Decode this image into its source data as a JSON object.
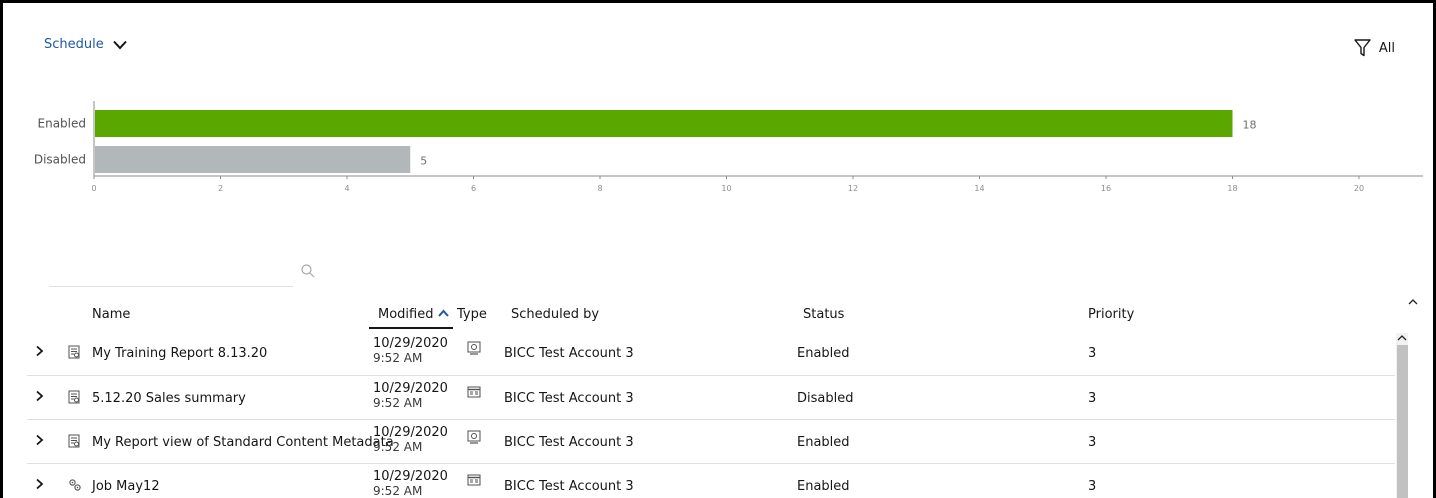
{
  "header": {
    "schedule_label": "Schedule",
    "filter_label": "All"
  },
  "chart_data": {
    "type": "bar",
    "orientation": "horizontal",
    "categories": [
      "Enabled",
      "Disabled"
    ],
    "values": [
      18,
      5
    ],
    "colors": [
      "#5aa700",
      "#b2b7ba"
    ],
    "xlim": [
      0,
      20
    ],
    "xticks": [
      0,
      2,
      4,
      6,
      8,
      10,
      12,
      14,
      16,
      18,
      20
    ],
    "grid": false,
    "title": "",
    "xlabel": "",
    "ylabel": ""
  },
  "search": {
    "placeholder": ""
  },
  "table": {
    "columns": {
      "name": "Name",
      "modified": "Modified",
      "type": "Type",
      "scheduled_by": "Scheduled by",
      "status": "Status",
      "priority": "Priority"
    },
    "rows": [
      {
        "name": "My Training Report 8.13.20",
        "icon": "report-icon",
        "date": "10/29/2020",
        "time": "9:52 AM",
        "type_icon": "report-view-icon",
        "scheduled_by": "BICC Test Account 3",
        "status": "Enabled",
        "priority": "3"
      },
      {
        "name": "5.12.20 Sales summary",
        "icon": "report-icon",
        "date": "10/29/2020",
        "time": "9:52 AM",
        "type_icon": "report-icon",
        "scheduled_by": "BICC Test Account 3",
        "status": "Disabled",
        "priority": "3"
      },
      {
        "name": "My Report view of Standard Content Metadata",
        "icon": "report-icon",
        "date": "10/29/2020",
        "time": "9:52 AM",
        "type_icon": "report-view-icon",
        "scheduled_by": "BICC Test Account 3",
        "status": "Enabled",
        "priority": "3"
      },
      {
        "name": "Job May12",
        "icon": "job-icon",
        "date": "10/29/2020",
        "time": "9:52 AM",
        "type_icon": "report-icon",
        "scheduled_by": "BICC Test Account 3",
        "status": "Enabled",
        "priority": "3"
      }
    ]
  },
  "colors": {
    "link": "#1f57a4",
    "enabled_bar": "#5aa700",
    "disabled_bar": "#b2b7ba"
  }
}
